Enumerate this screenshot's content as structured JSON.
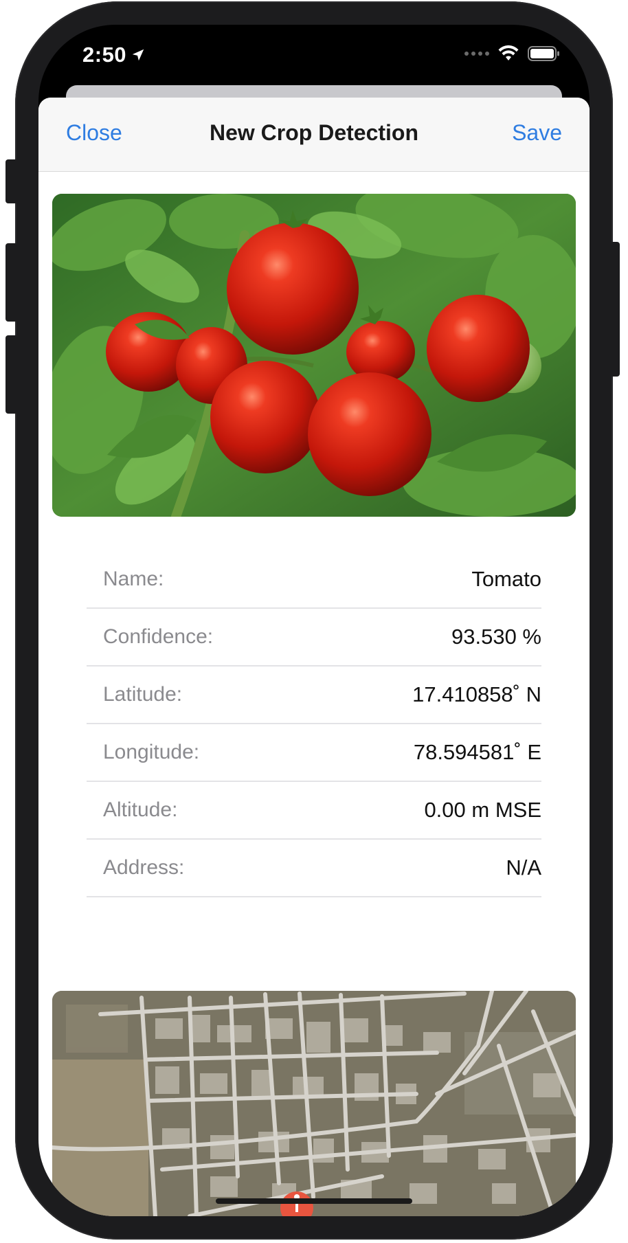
{
  "status_bar": {
    "time": "2:50",
    "icons": [
      "location-arrow-icon",
      "signal-dots-icon",
      "wifi-icon",
      "battery-icon"
    ]
  },
  "nav": {
    "close_label": "Close",
    "title": "New Crop Detection",
    "save_label": "Save"
  },
  "photo": {
    "subject": "tomato-plant-photo"
  },
  "details": [
    {
      "label": "Name:",
      "value": "Tomato"
    },
    {
      "label": "Confidence:",
      "value": "93.530 %"
    },
    {
      "label": "Latitude:",
      "value": "17.410858˚ N"
    },
    {
      "label": "Longitude:",
      "value": "78.594581˚ E"
    },
    {
      "label": "Altitude:",
      "value": "0.00 m MSE"
    },
    {
      "label": "Address:",
      "value": "N/A"
    }
  ],
  "map": {
    "type": "satellite",
    "pin_icon": "map-pin-icon",
    "pin_color": "#e8553f"
  },
  "colors": {
    "accent": "#2f7de1",
    "label_gray": "#8a8a8e",
    "frame": "#1c1c1e"
  }
}
